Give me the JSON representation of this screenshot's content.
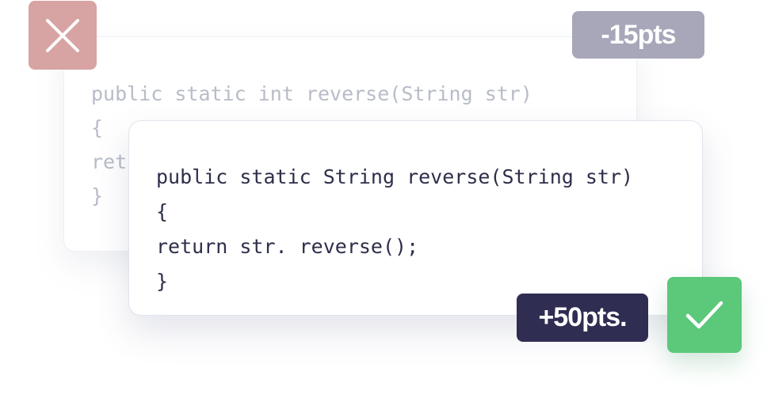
{
  "wrong_answer": {
    "code_lines": [
      "public static int reverse(String str)",
      "{",
      "ret",
      "}"
    ],
    "penalty_label": "-15pts",
    "icon": "close-icon",
    "badge_color": "#d8a3a3"
  },
  "correct_answer": {
    "code_lines": [
      "public static String reverse(String str)",
      "{",
      "return str. reverse();",
      "}"
    ],
    "reward_label": "+50pts.",
    "icon": "check-icon",
    "badge_color": "#5cc87a"
  },
  "colors": {
    "penalty_pill": "#a7a7b9",
    "reward_pill": "#2f2d52",
    "code_text": "#2d2f4a",
    "faded_code_text": "#b8bcc8"
  }
}
